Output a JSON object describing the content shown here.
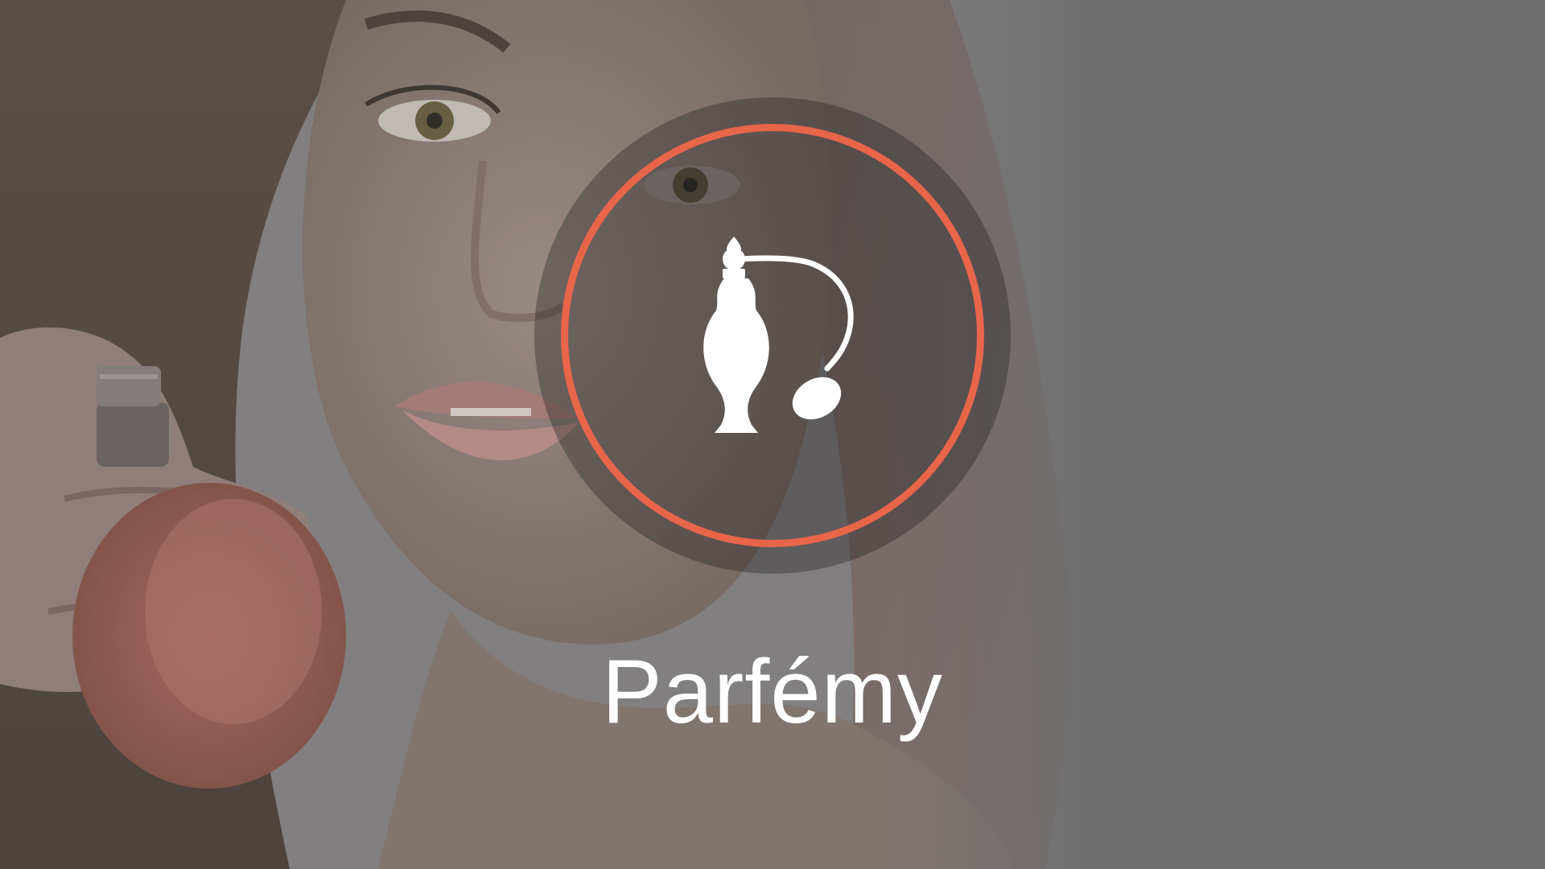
{
  "category": {
    "title": "Parfémy",
    "icon": "perfume-atomizer-icon"
  },
  "colors": {
    "background": "#737373",
    "ring": "#e8654a",
    "text": "#ffffff"
  }
}
